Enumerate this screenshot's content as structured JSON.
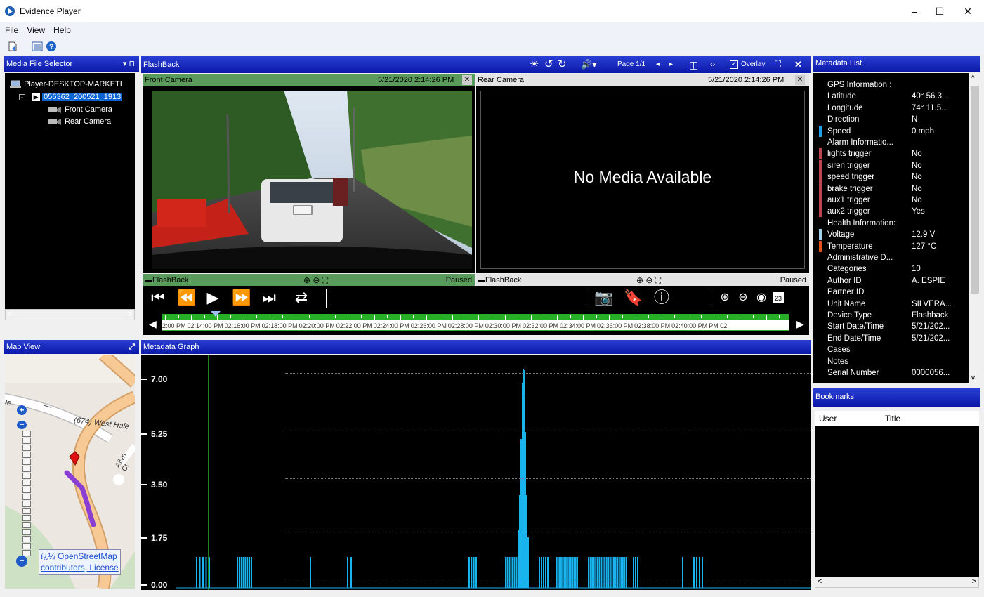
{
  "app": {
    "title": "Evidence Player",
    "minimize": "–",
    "maximize": "☐",
    "close": "✕"
  },
  "menu": {
    "file": "File",
    "view": "View",
    "help": "Help"
  },
  "media_selector": {
    "title": "Media File Selector",
    "pin": "▾ ⊓",
    "root": "Player-DESKTOP-MARKETI",
    "file": "056362_200521_1913",
    "children": [
      "Front Camera",
      "Rear Camera"
    ]
  },
  "flashback": {
    "title": "FlashBack",
    "page": "Page 1/1",
    "overlay": "Overlay",
    "front": {
      "label": "Front Camera",
      "time": "5/21/2020 2:14:26 PM",
      "footer": "FlashBack",
      "status": "Paused"
    },
    "rear": {
      "label": "Rear Camera",
      "time": "5/21/2020 2:14:26 PM",
      "footer": "FlashBack",
      "status": "Paused",
      "no_media": "No Media Available"
    },
    "timeline": [
      "2:00 PM",
      "02:14:00 PM",
      "02:16:00 PM",
      "02:18:00 PM",
      "02:20:00 PM",
      "02:22:00 PM",
      "02:24:00 PM",
      "02:26:00 PM",
      "02:28:00 PM",
      "02:30:00 PM",
      "02:32:00 PM",
      "02:34:00 PM",
      "02:36:00 PM",
      "02:38:00 PM",
      "02:40:00 PM",
      "PM 02"
    ],
    "calendar_day": "23"
  },
  "metadata_list": {
    "title": "Metadata List",
    "rows": [
      {
        "k": "GPS Information :",
        "v": "",
        "bar": ""
      },
      {
        "k": "Latitude",
        "v": "40° 56.3...",
        "bar": ""
      },
      {
        "k": "Longitude",
        "v": "74° 11.5...",
        "bar": ""
      },
      {
        "k": "Direction",
        "v": "N",
        "bar": ""
      },
      {
        "k": "Speed",
        "v": "0 mph",
        "bar": "#1ea0e8"
      },
      {
        "k": "Alarm Informatio...",
        "v": "",
        "bar": ""
      },
      {
        "k": "lights trigger",
        "v": "No",
        "bar": "#c0474f"
      },
      {
        "k": "siren trigger",
        "v": "No",
        "bar": "#c0474f"
      },
      {
        "k": "speed trigger",
        "v": "No",
        "bar": "#c0474f"
      },
      {
        "k": "brake trigger",
        "v": "No",
        "bar": "#c0474f"
      },
      {
        "k": "aux1 trigger",
        "v": "No",
        "bar": "#c0474f"
      },
      {
        "k": "aux2 trigger",
        "v": "Yes",
        "bar": "#c0474f"
      },
      {
        "k": "Health Information:",
        "v": "",
        "bar": ""
      },
      {
        "k": "Voltage",
        "v": "12.9 V",
        "bar": "#9fd4ec"
      },
      {
        "k": "Temperature",
        "v": "127 °C",
        "bar": "#e8501c"
      },
      {
        "k": "Administrative D...",
        "v": "",
        "bar": ""
      },
      {
        "k": "Categories",
        "v": "10",
        "bar": ""
      },
      {
        "k": "Author ID",
        "v": "A. ESPIE",
        "bar": ""
      },
      {
        "k": "Partner ID",
        "v": "",
        "bar": ""
      },
      {
        "k": "Unit Name",
        "v": "SILVERA...",
        "bar": ""
      },
      {
        "k": "Device Type",
        "v": "Flashback",
        "bar": ""
      },
      {
        "k": "Start Date/Time",
        "v": "5/21/202...",
        "bar": ""
      },
      {
        "k": "End Date/Time",
        "v": "5/21/202...",
        "bar": ""
      },
      {
        "k": "Cases",
        "v": "",
        "bar": ""
      },
      {
        "k": "Notes",
        "v": "",
        "bar": ""
      },
      {
        "k": "Serial Number",
        "v": "0000056...",
        "bar": ""
      }
    ]
  },
  "bookmarks": {
    "title": "Bookmarks",
    "col_user": "User",
    "col_title": "Title"
  },
  "map": {
    "title": "Map View",
    "road_label": "(674) West Hale",
    "road_number": "(674)",
    "side_label": "Allyn Ct",
    "partial_label": "ue",
    "attribution_1": "ï¿½ OpenStreetMap",
    "attribution_2": "contributors, License"
  },
  "graph": {
    "title": "Metadata Graph",
    "y_labels": [
      "7.00",
      "5.25",
      "3.50",
      "1.75",
      "0.00"
    ],
    "colors": {
      "series": "#19b3ee",
      "cursor": "#22b022"
    }
  }
}
